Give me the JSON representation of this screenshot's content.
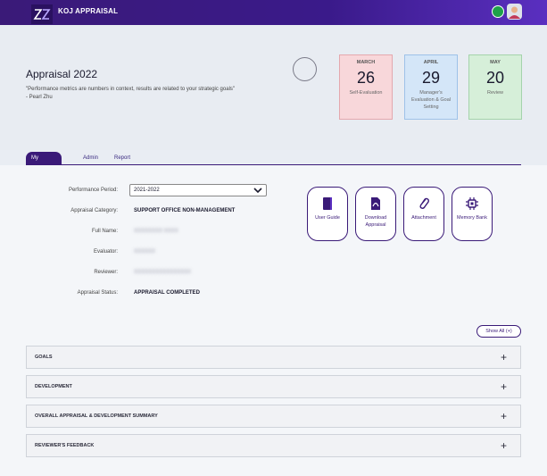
{
  "app": {
    "title": "KOJ APPRAISAL"
  },
  "hero": {
    "title": "Appraisal 2022",
    "quote": "\"Performance metrics are numbers in context, results are related to your strategic goals\"",
    "author": "- Pearl Zhu"
  },
  "cards": [
    {
      "month": "MARCH",
      "day": "26",
      "label": "Self-Evaluation",
      "color": "#f8d7da"
    },
    {
      "month": "APRIL",
      "day": "29",
      "label": "Manager's Evaluation & Goal Setting",
      "color": "#d4e6f8"
    },
    {
      "month": "MAY",
      "day": "20",
      "label": "Review",
      "color": "#d6efd9"
    }
  ],
  "tabs": [
    "My Evaluation",
    "Admin",
    "Report"
  ],
  "fields": {
    "period_label": "Performance Period:",
    "period_value": "2021-2022",
    "category_label": "Appraisal Category:",
    "category_value": "SUPPORT OFFICE NON-MANAGEMENT",
    "fullname_label": "Full Name:",
    "evaluator_label": "Evaluator:",
    "reviewer_label": "Reviewer:",
    "status_label": "Appraisal Status:",
    "status_value": "APPRAISAL COMPLETED"
  },
  "quick_buttons": [
    "User Guide",
    "Download Appraisal",
    "Attachment",
    "Memory Bank"
  ],
  "show_all": "Show All (+)",
  "sections": [
    "GOALS",
    "DEVELOPMENT",
    "OVERALL APPRAISAL & DEVELOPMENT SUMMARY",
    "REVIEWER'S FEEDBACK"
  ],
  "colors": {
    "brand": "#3a1a78",
    "accent": "#5a2fc0"
  }
}
